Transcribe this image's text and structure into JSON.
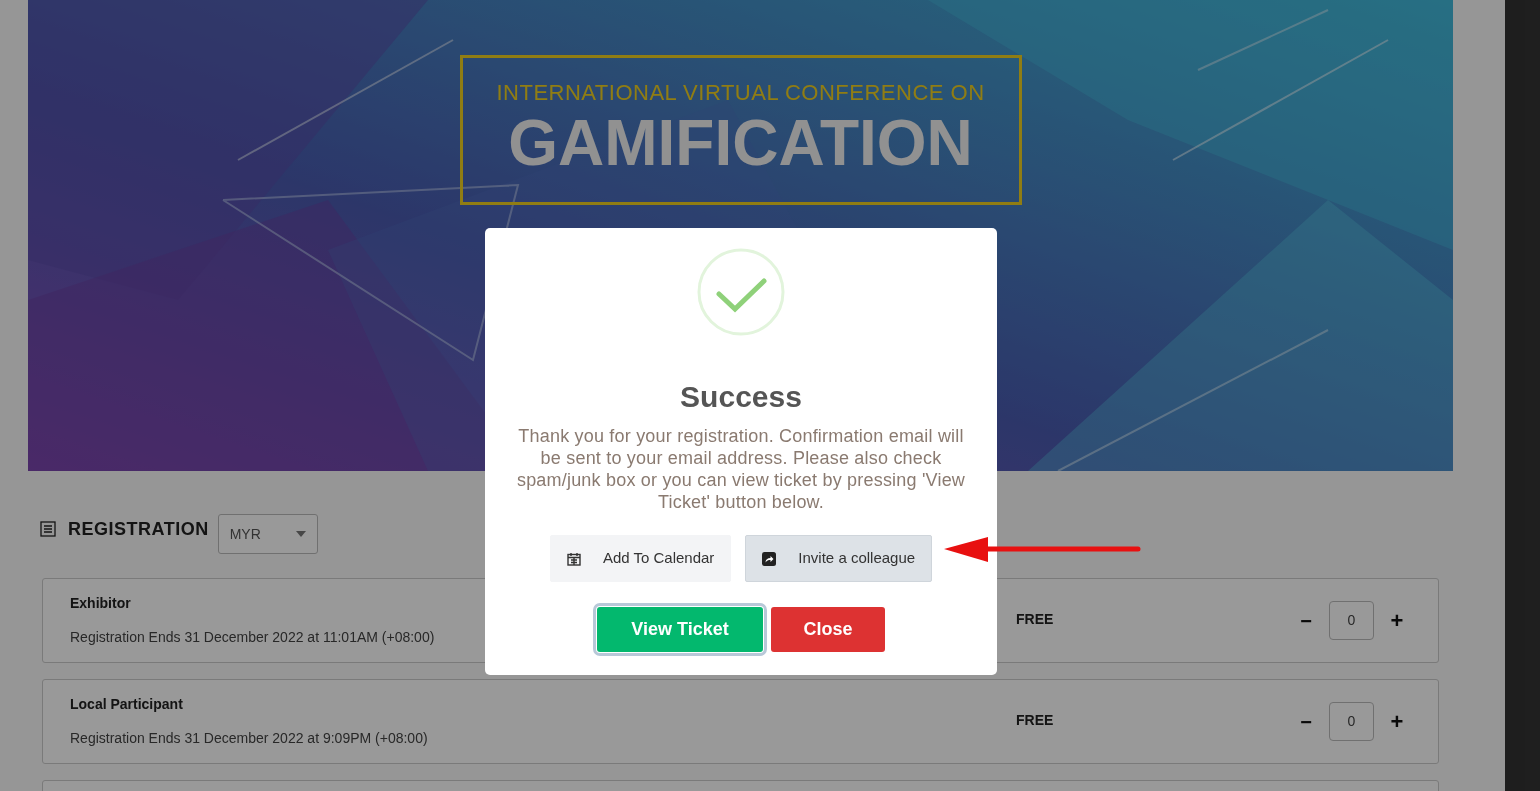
{
  "banner": {
    "kind": "picture",
    "subtitle": "INTERNATIONAL VIRTUAL CONFERENCE ON",
    "title": "GAMIFICATION"
  },
  "registration": {
    "heading": "REGISTRATION",
    "currency": "MYR",
    "tickets": [
      {
        "name": "Exhibitor",
        "ends": "Registration Ends 31 December 2022 at 11:01AM (+08:00)",
        "price": "FREE",
        "minus": "−",
        "quantity": "0",
        "plus": "+"
      },
      {
        "name": "Local Participant",
        "ends": "Registration Ends 31 December 2022 at 9:09PM (+08:00)",
        "price": "FREE",
        "minus": "−",
        "quantity": "0",
        "plus": "+"
      }
    ]
  },
  "modal": {
    "title": "Success",
    "message": "Thank you for your registration. Confirmation email will be sent to your email address. Please also check spam/junk box or you can view ticket by pressing 'View Ticket' button below.",
    "links": [
      {
        "label": "Add To Calendar",
        "kind": "calendar",
        "hovered": false
      },
      {
        "label": "Invite a colleague",
        "kind": "share",
        "hovered": true
      }
    ],
    "buttons": [
      {
        "label": "View Ticket",
        "kind": "primary",
        "focused": true
      },
      {
        "label": "Close",
        "kind": "danger",
        "focused": false
      }
    ]
  }
}
